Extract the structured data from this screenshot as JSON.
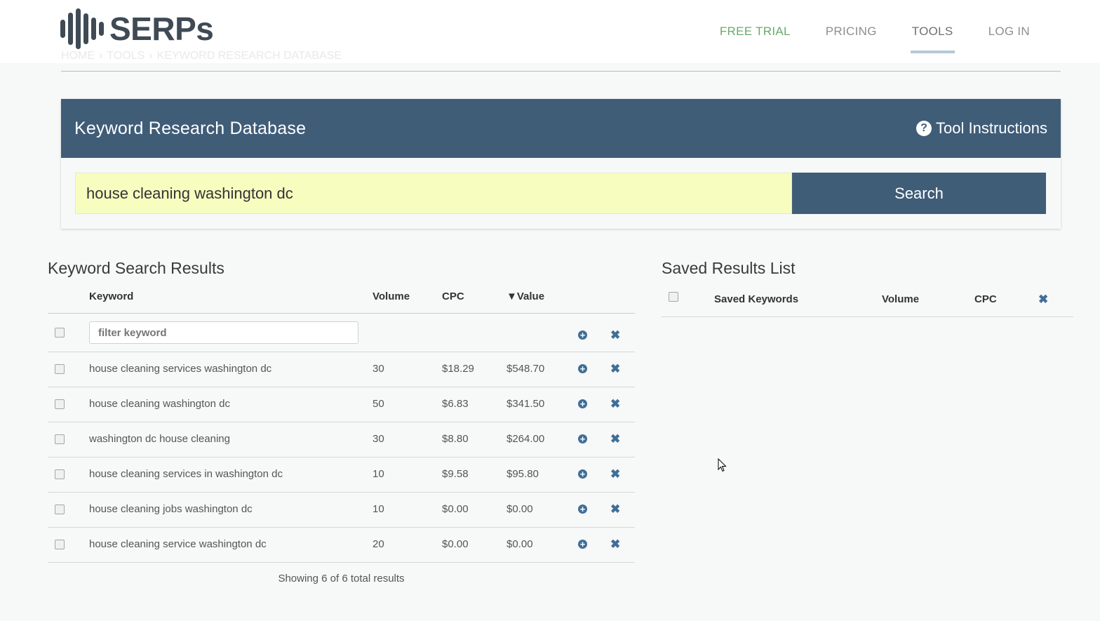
{
  "brand": {
    "name": "SERPs"
  },
  "nav": {
    "free_trial": "FREE TRIAL",
    "pricing": "PRICING",
    "tools": "TOOLS",
    "login": "LOG IN"
  },
  "breadcrumb": {
    "home": "HOME",
    "sep1": "›",
    "tools": "TOOLS",
    "sep2": "›",
    "current": "KEYWORD RESEARCH DATABASE"
  },
  "tool": {
    "title": "Keyword Research Database",
    "instructions_label": "Tool Instructions",
    "search_value": "house cleaning washington dc",
    "search_button": "Search"
  },
  "results": {
    "title": "Keyword Search Results",
    "columns": {
      "keyword": "Keyword",
      "volume": "Volume",
      "cpc": "CPC",
      "value": "▼Value"
    },
    "filter_placeholder": "filter keyword",
    "rows": [
      {
        "keyword": "house cleaning services washington dc",
        "volume": "30",
        "cpc": "$18.29",
        "value": "$548.70"
      },
      {
        "keyword": "house cleaning washington dc",
        "volume": "50",
        "cpc": "$6.83",
        "value": "$341.50"
      },
      {
        "keyword": "washington dc house cleaning",
        "volume": "30",
        "cpc": "$8.80",
        "value": "$264.00"
      },
      {
        "keyword": "house cleaning services in washington dc",
        "volume": "10",
        "cpc": "$9.58",
        "value": "$95.80"
      },
      {
        "keyword": "house cleaning jobs washington dc",
        "volume": "10",
        "cpc": "$0.00",
        "value": "$0.00"
      },
      {
        "keyword": "house cleaning service washington dc",
        "volume": "20",
        "cpc": "$0.00",
        "value": "$0.00"
      }
    ],
    "footer": "Showing 6 of 6 total results"
  },
  "saved": {
    "title": "Saved Results List",
    "columns": {
      "keywords": "Saved Keywords",
      "volume": "Volume",
      "cpc": "CPC"
    }
  },
  "colors": {
    "primary": "#405d78",
    "accent_green": "#6aaa6a",
    "search_bg": "#f7fdbf",
    "icon_blue": "#3f6e98"
  }
}
